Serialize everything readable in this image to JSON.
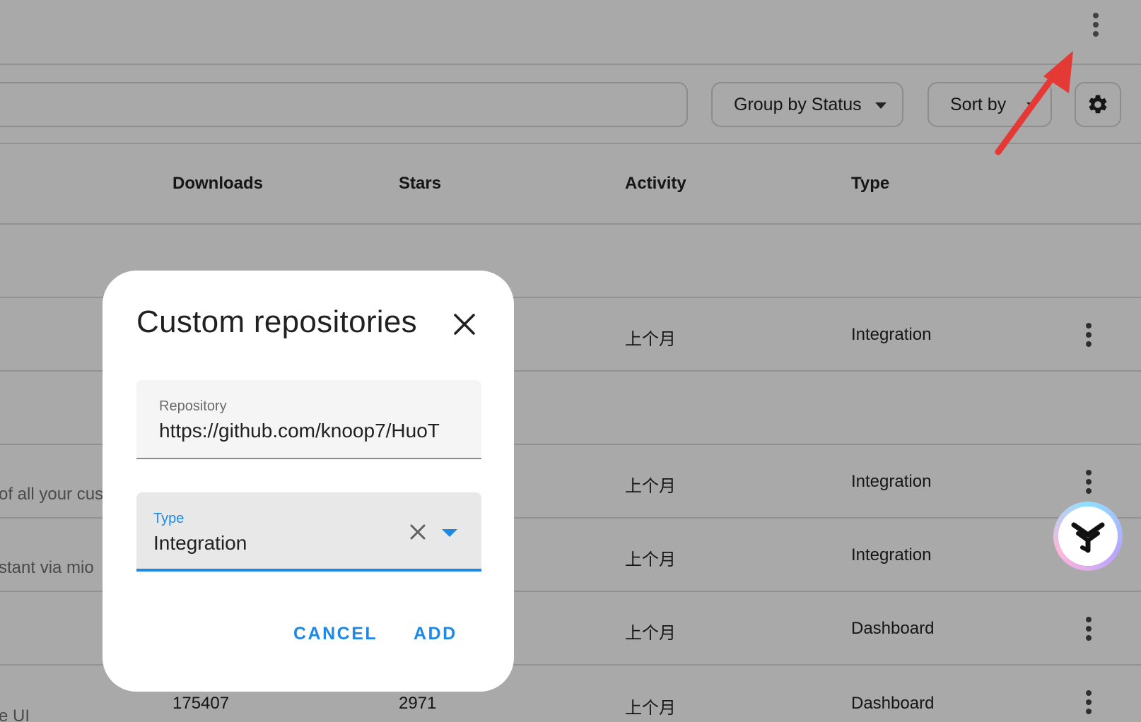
{
  "toolbar": {
    "more_icon": "more-vertical-icon",
    "group_by_label": "Group by Status",
    "sort_by_label": "Sort by",
    "settings_icon": "gear-icon"
  },
  "table": {
    "headers": {
      "downloads": "Downloads",
      "stars": "Stars",
      "activity": "Activity",
      "type": "Type"
    },
    "rows": [
      {
        "description": "",
        "downloads": "",
        "stars": "",
        "activity": "上个月",
        "type": "Integration"
      },
      {
        "description": "",
        "downloads": "",
        "stars": "",
        "activity": "",
        "type": ""
      },
      {
        "description": "of all your cus",
        "downloads": "",
        "stars": "",
        "activity": "上个月",
        "type": "Integration"
      },
      {
        "description": "stant via mio",
        "downloads": "",
        "stars": "",
        "activity": "上个月",
        "type": "Integration"
      },
      {
        "description": "",
        "downloads": "",
        "stars": "",
        "activity": "上个月",
        "type": "Dashboard"
      },
      {
        "description": "e UI",
        "downloads": "175407",
        "stars": "2971",
        "activity": "上个月",
        "type": "Dashboard"
      }
    ]
  },
  "dialog": {
    "title": "Custom repositories",
    "close_icon": "close-icon",
    "repository": {
      "label": "Repository",
      "value": "https://github.com/knoop7/HuoT"
    },
    "type": {
      "label": "Type",
      "value": "Integration",
      "clear_icon": "clear-icon",
      "dropdown_icon": "dropdown-arrow-icon"
    },
    "cancel_label": "CANCEL",
    "add_label": "ADD"
  },
  "colors": {
    "accent": "#1e88e5",
    "annotation_arrow": "#e53935",
    "scrim": "rgba(0,0,0,0.32)"
  }
}
